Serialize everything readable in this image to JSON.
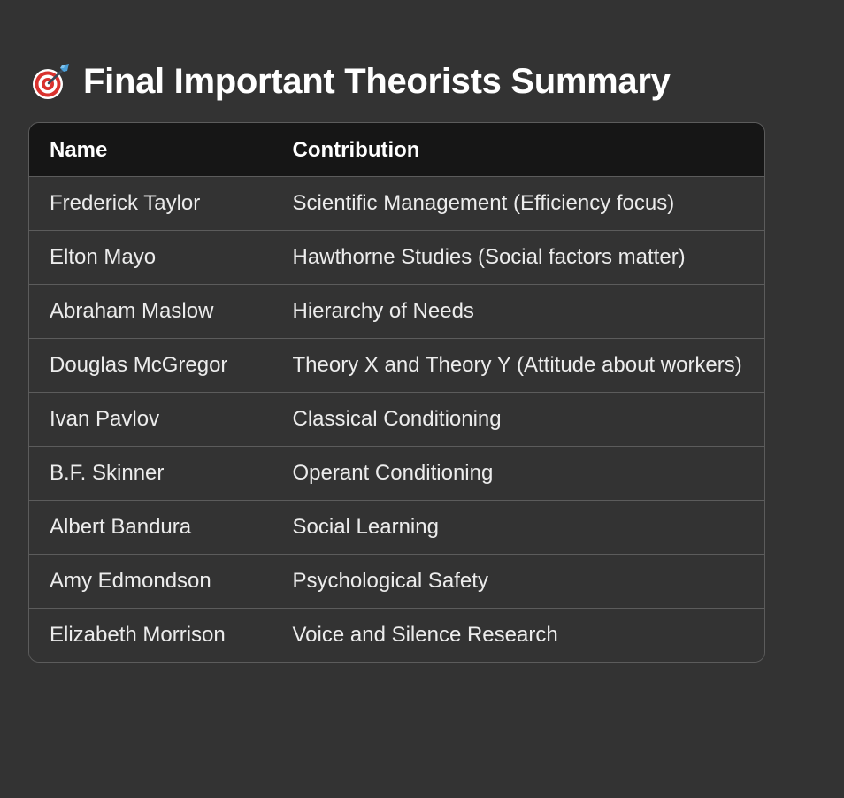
{
  "heading": {
    "icon": "target-dart-icon",
    "title": "Final Important Theorists Summary"
  },
  "table": {
    "headers": [
      "Name",
      "Contribution"
    ],
    "rows": [
      {
        "name": "Frederick Taylor",
        "contribution": "Scientific Management (Efficiency focus)"
      },
      {
        "name": "Elton Mayo",
        "contribution": "Hawthorne Studies (Social factors matter)"
      },
      {
        "name": "Abraham Maslow",
        "contribution": "Hierarchy of Needs"
      },
      {
        "name": "Douglas McGregor",
        "contribution": "Theory X and Theory Y (Attitude about workers)"
      },
      {
        "name": "Ivan Pavlov",
        "contribution": "Classical Conditioning"
      },
      {
        "name": "B.F. Skinner",
        "contribution": "Operant Conditioning"
      },
      {
        "name": "Albert Bandura",
        "contribution": "Social Learning"
      },
      {
        "name": "Amy Edmondson",
        "contribution": "Psychological Safety"
      },
      {
        "name": "Elizabeth Morrison",
        "contribution": "Voice and Silence Research"
      }
    ]
  },
  "colors": {
    "background": "#333333",
    "header_background": "#161616",
    "border": "#5c5c5c",
    "text": "#ececec"
  }
}
